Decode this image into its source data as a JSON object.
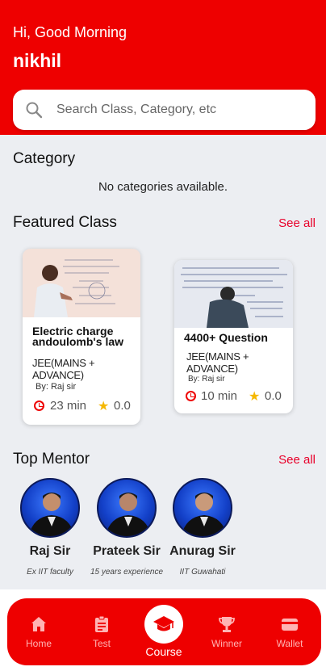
{
  "header": {
    "greeting": "Hi, Good Morning",
    "username": "nikhil",
    "search": {
      "placeholder": "Search Class, Category, etc",
      "icon": "search-icon"
    }
  },
  "category": {
    "title": "Category",
    "empty_message": "No categories available."
  },
  "featured": {
    "title": "Featured Class",
    "see_all": "See all",
    "cards": [
      {
        "title": "Electric charge andoulomb's law",
        "exam": "JEE(MAINS + ADVANCE)",
        "by": "By: Raj sir",
        "duration": "23 min",
        "rating": "0.0"
      },
      {
        "title": "4400+ Question",
        "exam": "JEE(MAINS + ADVANCE)",
        "by": "By: Raj sir",
        "duration": "10 min",
        "rating": "0.0"
      }
    ]
  },
  "mentors": {
    "title": "Top Mentor",
    "see_all": "See all",
    "items": [
      {
        "name": "Raj Sir",
        "description": "Ex IIT faculty"
      },
      {
        "name": "Prateek Sir",
        "description": "15 years experience"
      },
      {
        "name": "Anurag Sir",
        "description": "IIT Guwahati"
      }
    ]
  },
  "nav": {
    "home": "Home",
    "test": "Test",
    "course": "Course",
    "winner": "Winner",
    "wallet": "Wallet"
  },
  "colors": {
    "primary": "#ee0000",
    "accent_link": "#e8002a",
    "star": "#f5b800",
    "background": "#eceef2"
  }
}
